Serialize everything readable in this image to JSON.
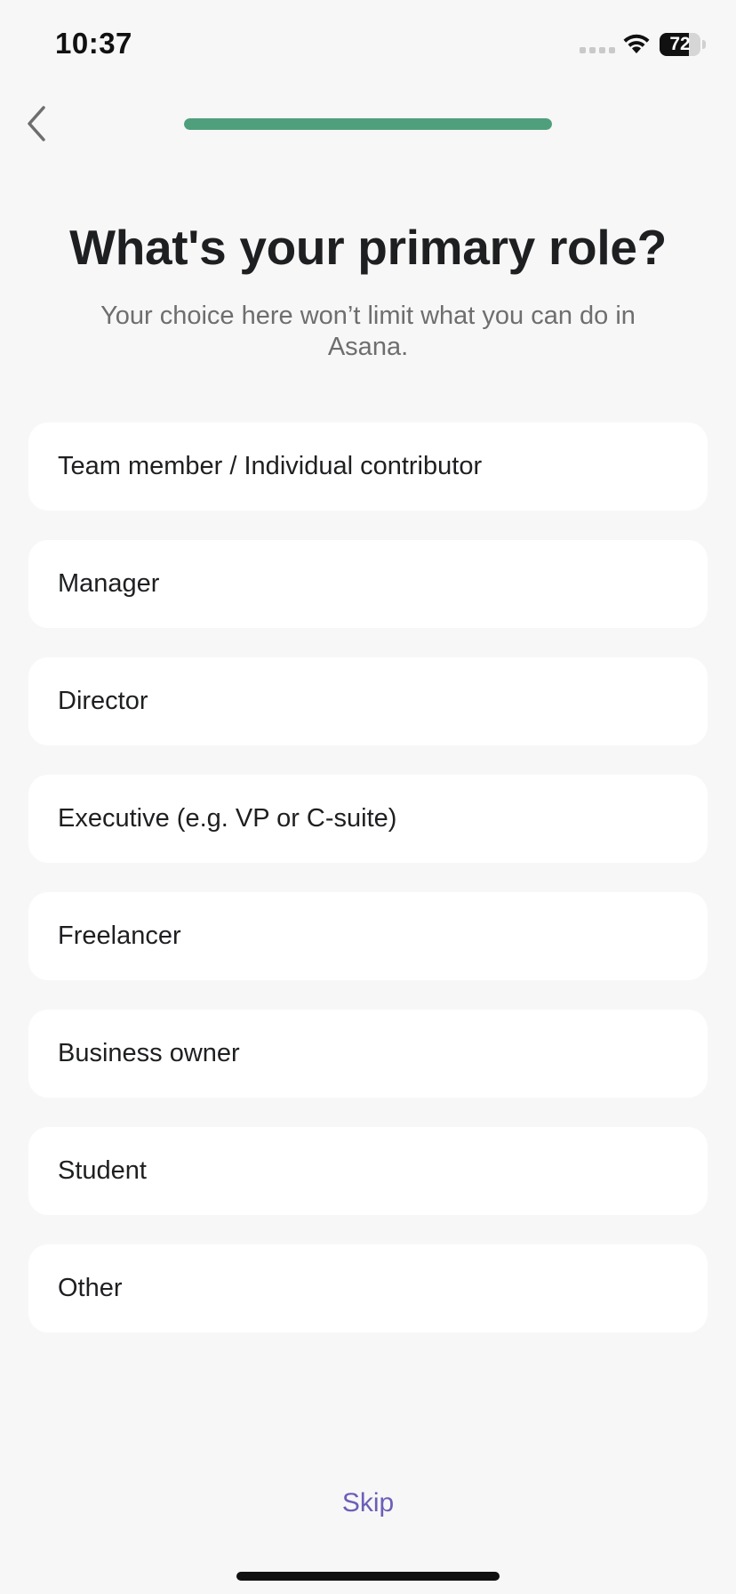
{
  "status_bar": {
    "time": "10:37",
    "battery_level": "72",
    "battery_fraction": 0.72
  },
  "nav": {
    "back_icon": "chevron-left-icon",
    "progress": {
      "fraction": 1.0,
      "color": "#4f9f7d"
    }
  },
  "header": {
    "title": "What's your primary role?",
    "subtitle": "Your choice here won’t limit what you can do in Asana."
  },
  "options": [
    {
      "label": "Team member / Individual contributor"
    },
    {
      "label": "Manager"
    },
    {
      "label": "Director"
    },
    {
      "label": "Executive (e.g. VP or C-suite)"
    },
    {
      "label": "Freelancer"
    },
    {
      "label": "Business owner"
    },
    {
      "label": "Student"
    },
    {
      "label": "Other"
    }
  ],
  "footer": {
    "skip_label": "Skip",
    "skip_color": "#6a5fb8"
  }
}
